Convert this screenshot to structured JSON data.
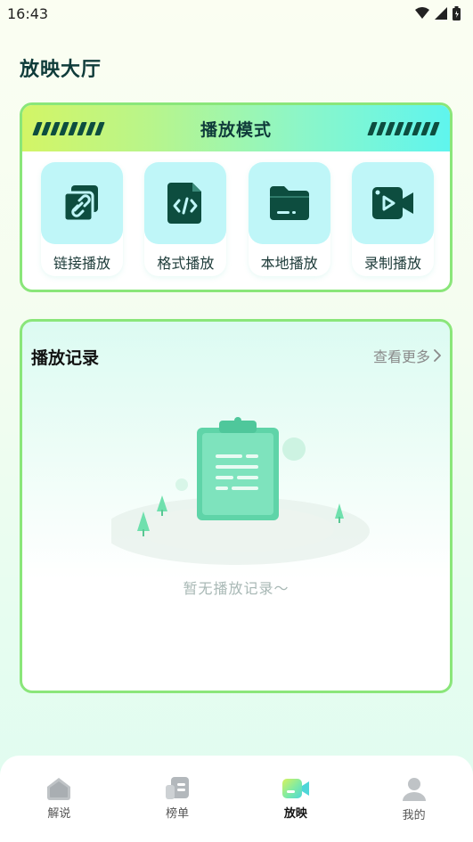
{
  "status_bar": {
    "time": "16:43",
    "icons": [
      "wifi-icon",
      "signal-icon",
      "battery-icon"
    ]
  },
  "page": {
    "title": "放映大厅"
  },
  "mode_section": {
    "title": "播放模式",
    "items": [
      {
        "label": "链接播放",
        "icon": "link-icon"
      },
      {
        "label": "格式播放",
        "icon": "code-file-icon"
      },
      {
        "label": "本地播放",
        "icon": "folder-icon"
      },
      {
        "label": "录制播放",
        "icon": "video-camera-icon"
      }
    ]
  },
  "records_section": {
    "title": "播放记录",
    "see_more": "查看更多",
    "empty_text": "暂无播放记录～"
  },
  "bottom_nav": {
    "items": [
      {
        "label": "解说",
        "icon": "home-icon",
        "active": false
      },
      {
        "label": "榜单",
        "icon": "list-icon",
        "active": false
      },
      {
        "label": "放映",
        "icon": "camera-icon",
        "active": true
      },
      {
        "label": "我的",
        "icon": "user-icon",
        "active": false
      }
    ]
  },
  "colors": {
    "accent_green": "#8ae67a",
    "icon_dark": "#0d4d3f",
    "icon_tile": "#bff6f8",
    "title_dark": "#0f3b3a"
  }
}
